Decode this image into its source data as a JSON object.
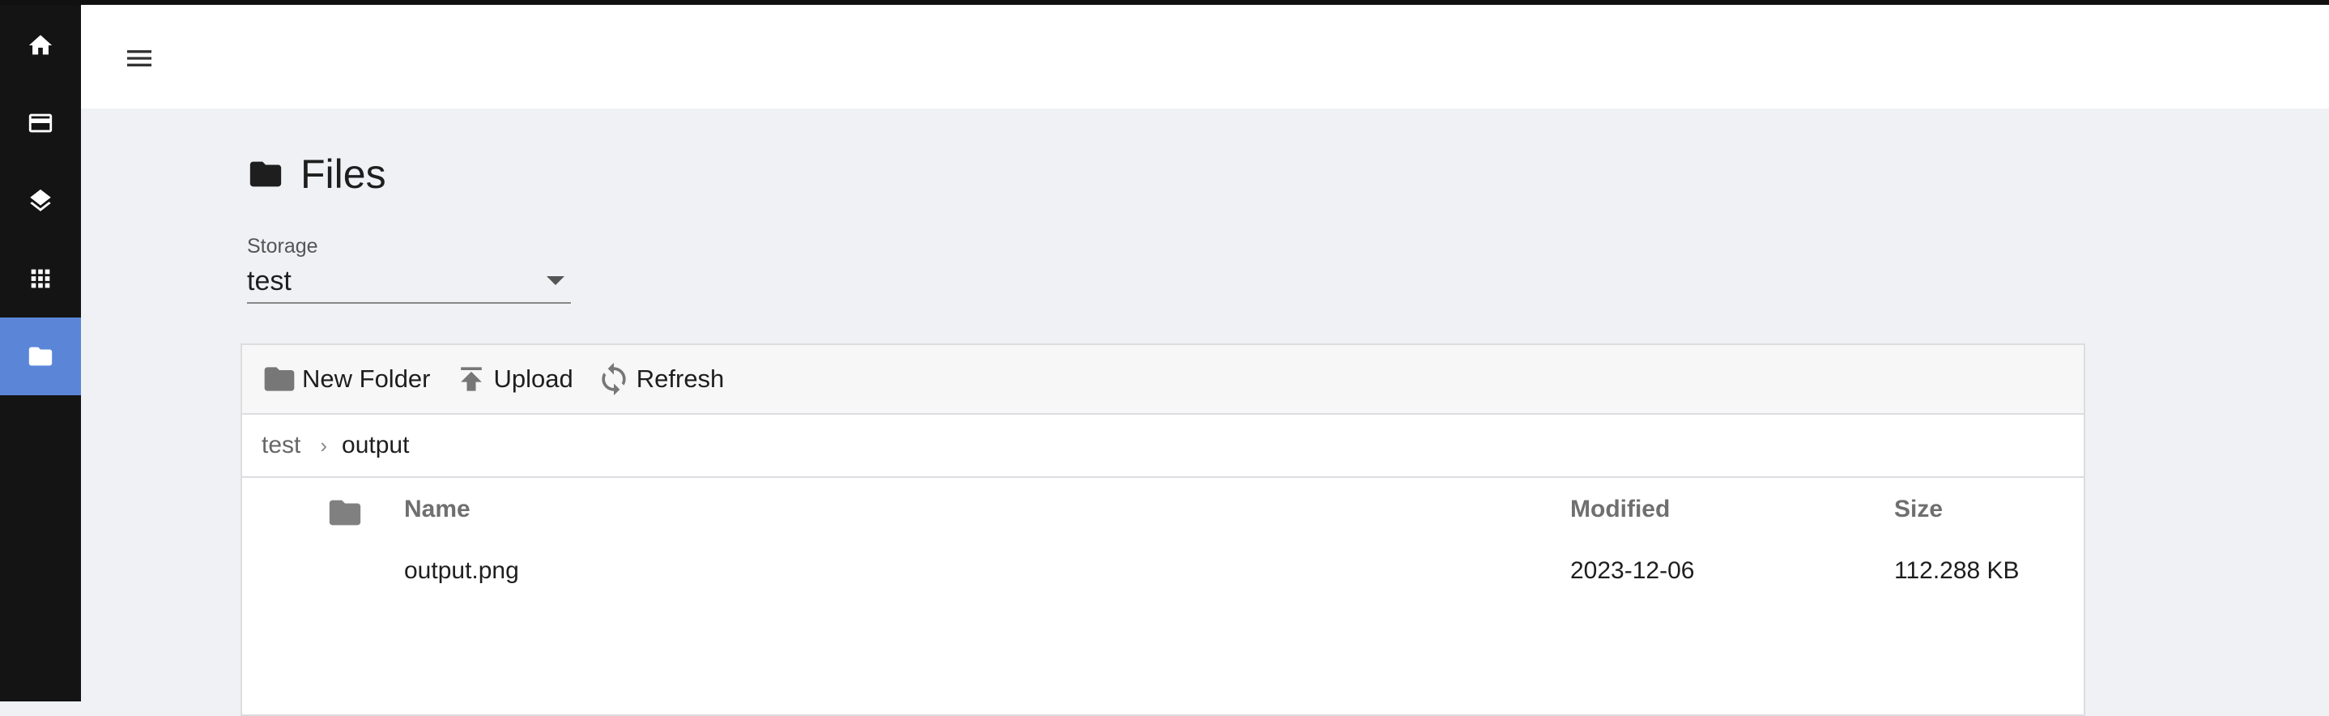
{
  "rail": {
    "items": [
      {
        "icon": "home-icon"
      },
      {
        "icon": "card-icon"
      },
      {
        "icon": "layers-icon"
      },
      {
        "icon": "apps-grid-icon"
      },
      {
        "icon": "folder-icon",
        "active": true
      }
    ]
  },
  "header": {
    "menu_icon": "hamburger-menu-icon"
  },
  "page": {
    "title": "Files"
  },
  "storage": {
    "label": "Storage",
    "value": "test"
  },
  "toolbar": {
    "new_folder": "New Folder",
    "upload": "Upload",
    "refresh": "Refresh"
  },
  "breadcrumb": {
    "parent": "test",
    "current": "output"
  },
  "table": {
    "headers": {
      "name": "Name",
      "modified": "Modified",
      "size": "Size"
    },
    "rows": [
      {
        "name": "output.png",
        "modified": "2023-12-06",
        "size": "112.288 KB"
      }
    ]
  },
  "colors": {
    "accent": "#5b86d8",
    "rail": "#141414",
    "background": "#eff1f5"
  }
}
